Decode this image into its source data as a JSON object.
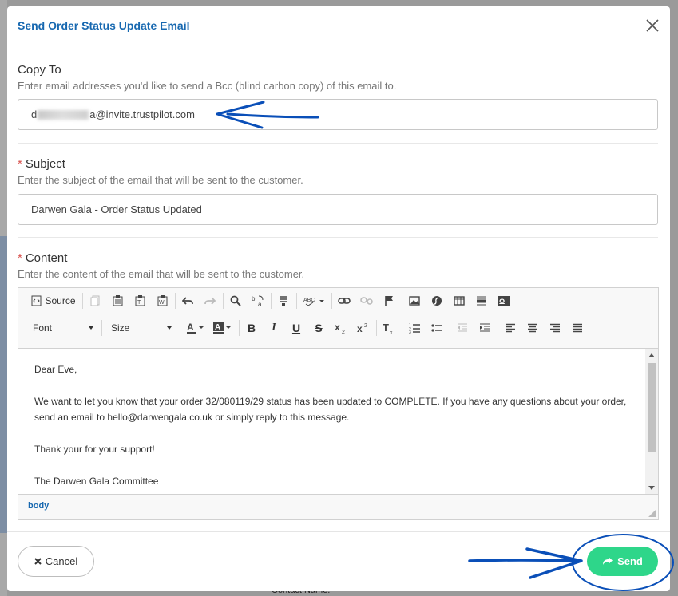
{
  "modal": {
    "title": "Send Order Status Update Email",
    "close_icon": "close-icon"
  },
  "copy_to": {
    "label": "Copy To",
    "help": "Enter email addresses you'd like to send a Bcc (blind carbon copy) of this email to.",
    "value_prefix": "d",
    "value_suffix": "a@invite.trustpilot.com"
  },
  "subject": {
    "required_marker": "*",
    "label": "Subject",
    "help": "Enter the subject of the email that will be sent to the customer.",
    "value": "Darwen Gala - Order Status Updated"
  },
  "content": {
    "required_marker": "*",
    "label": "Content",
    "help": "Enter the content of the email that will be sent to the customer."
  },
  "editor": {
    "source_label": "Source",
    "font_label": "Font",
    "size_label": "Size",
    "body": {
      "greeting": "Dear Eve,",
      "paragraph1": "We want to let you know that your order 32/080119/29 status has been updated to COMPLETE. If you have any questions about your order, send an email to hello@darwengala.co.uk or simply reply to this message.",
      "thanks": "Thank your for your support!",
      "signoff": "The Darwen Gala Committee"
    },
    "path": "body"
  },
  "footer": {
    "cancel_label": "Cancel",
    "send_label": "Send"
  },
  "background": {
    "bottom_text": "Contact Name:"
  },
  "colors": {
    "title": "#1768b0",
    "send": "#2ed68a",
    "annotation": "#0a4fb8",
    "required": "#d9534f"
  }
}
